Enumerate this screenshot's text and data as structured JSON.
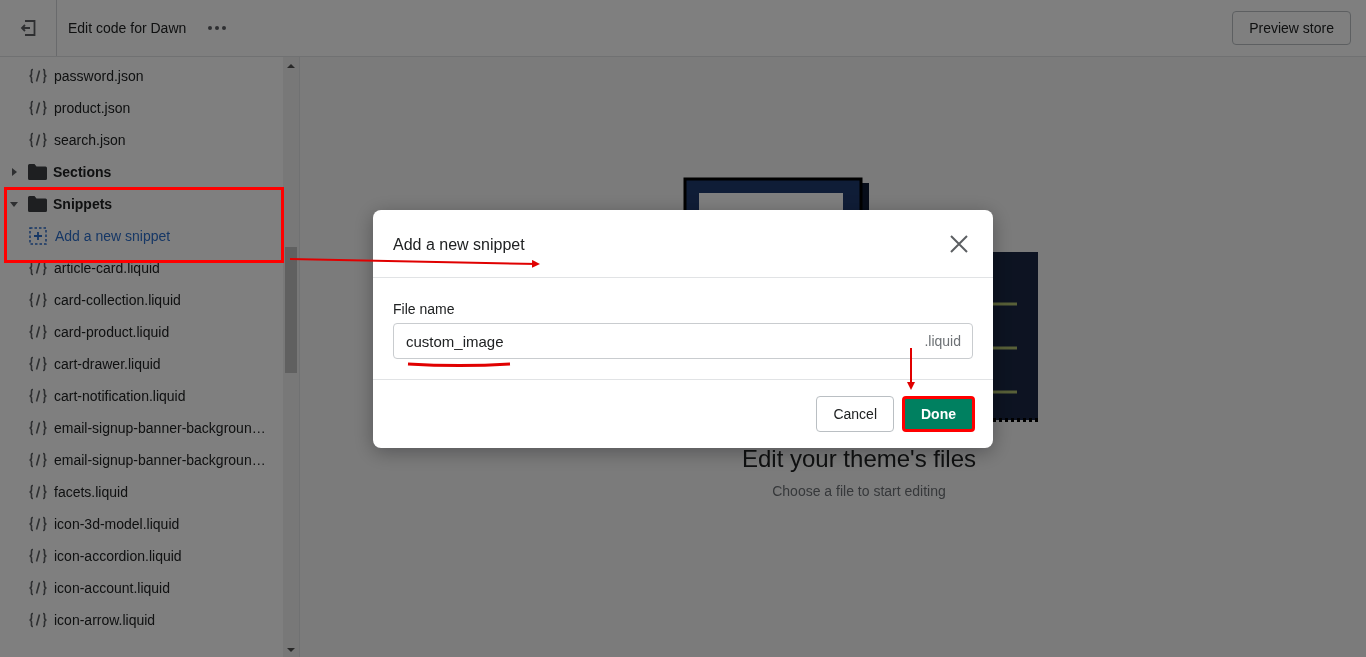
{
  "topbar": {
    "title": "Edit code for Dawn",
    "preview_button": "Preview store"
  },
  "sidebar": {
    "items": [
      {
        "kind": "file",
        "label": "password.json"
      },
      {
        "kind": "file",
        "label": "product.json"
      },
      {
        "kind": "file",
        "label": "search.json"
      },
      {
        "kind": "folder",
        "label": "Sections",
        "expanded": false
      },
      {
        "kind": "folder",
        "label": "Snippets",
        "expanded": true,
        "children": [
          {
            "kind": "add",
            "label": "Add a new snippet"
          },
          {
            "kind": "file",
            "label": "article-card.liquid"
          },
          {
            "kind": "file",
            "label": "card-collection.liquid"
          },
          {
            "kind": "file",
            "label": "card-product.liquid"
          },
          {
            "kind": "file",
            "label": "cart-drawer.liquid"
          },
          {
            "kind": "file",
            "label": "cart-notification.liquid"
          },
          {
            "kind": "file",
            "label": "email-signup-banner-backgroun…"
          },
          {
            "kind": "file",
            "label": "email-signup-banner-backgroun…"
          },
          {
            "kind": "file",
            "label": "facets.liquid"
          },
          {
            "kind": "file",
            "label": "icon-3d-model.liquid"
          },
          {
            "kind": "file",
            "label": "icon-accordion.liquid"
          },
          {
            "kind": "file",
            "label": "icon-account.liquid"
          },
          {
            "kind": "file",
            "label": "icon-arrow.liquid"
          }
        ]
      }
    ]
  },
  "main": {
    "heading": "Edit your theme's files",
    "caption": "Choose a file to start editing"
  },
  "dialog": {
    "title": "Add a new snippet",
    "field": {
      "label": "File name",
      "value": "custom_image",
      "suffix": ".liquid"
    },
    "buttons": [
      {
        "kind": "secondary",
        "label": "Cancel"
      },
      {
        "kind": "primary",
        "label": "Done"
      }
    ]
  }
}
